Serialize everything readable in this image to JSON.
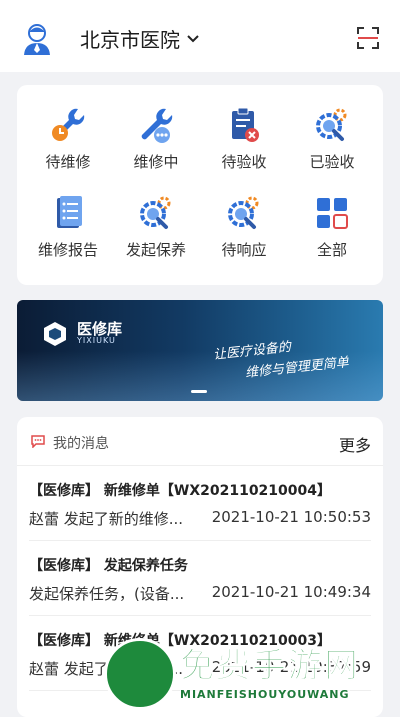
{
  "header": {
    "hospital": "北京市医院"
  },
  "grid": [
    {
      "label": "待维修",
      "icon": "wrench-clock-icon"
    },
    {
      "label": "维修中",
      "icon": "wrench-dots-icon"
    },
    {
      "label": "待验收",
      "icon": "clipboard-x-icon"
    },
    {
      "label": "已验收",
      "icon": "gear-search-icon"
    },
    {
      "label": "维修报告",
      "icon": "report-doc-icon"
    },
    {
      "label": "发起保养",
      "icon": "gear-search-icon"
    },
    {
      "label": "待响应",
      "icon": "gear-search-icon"
    },
    {
      "label": "全部",
      "icon": "grid-apps-icon"
    }
  ],
  "banner": {
    "brand": "医修库",
    "brand_en": "YIXIUKU",
    "slogan_line1": "让医疗设备的",
    "slogan_line2": "维修与管理更简单"
  },
  "messages": {
    "title": "我的消息",
    "more": "更多",
    "items": [
      {
        "title": "【医修库】 新维修单【WX202110210004】",
        "body": "赵蕾 发起了新的维修...",
        "time": "2021-10-21 10:50:53"
      },
      {
        "title": "【医修库】 发起保养任务",
        "body": "发起保养任务，(设备...",
        "time": "2021-10-21 10:49:34"
      },
      {
        "title": "【医修库】 新维修单【WX202110210003】",
        "body": "赵蕾 发起了新的维修...",
        "time": "2021-10-21 10:37:59"
      }
    ]
  },
  "watermark": {
    "text": "免费手游网",
    "en": "MIANFEISHOUYOUWANG"
  },
  "colors": {
    "accent": "#2f6fd6",
    "icon_red": "#e04b4b",
    "icon_orange": "#f08a24",
    "watermark_green": "#2a9a48"
  }
}
